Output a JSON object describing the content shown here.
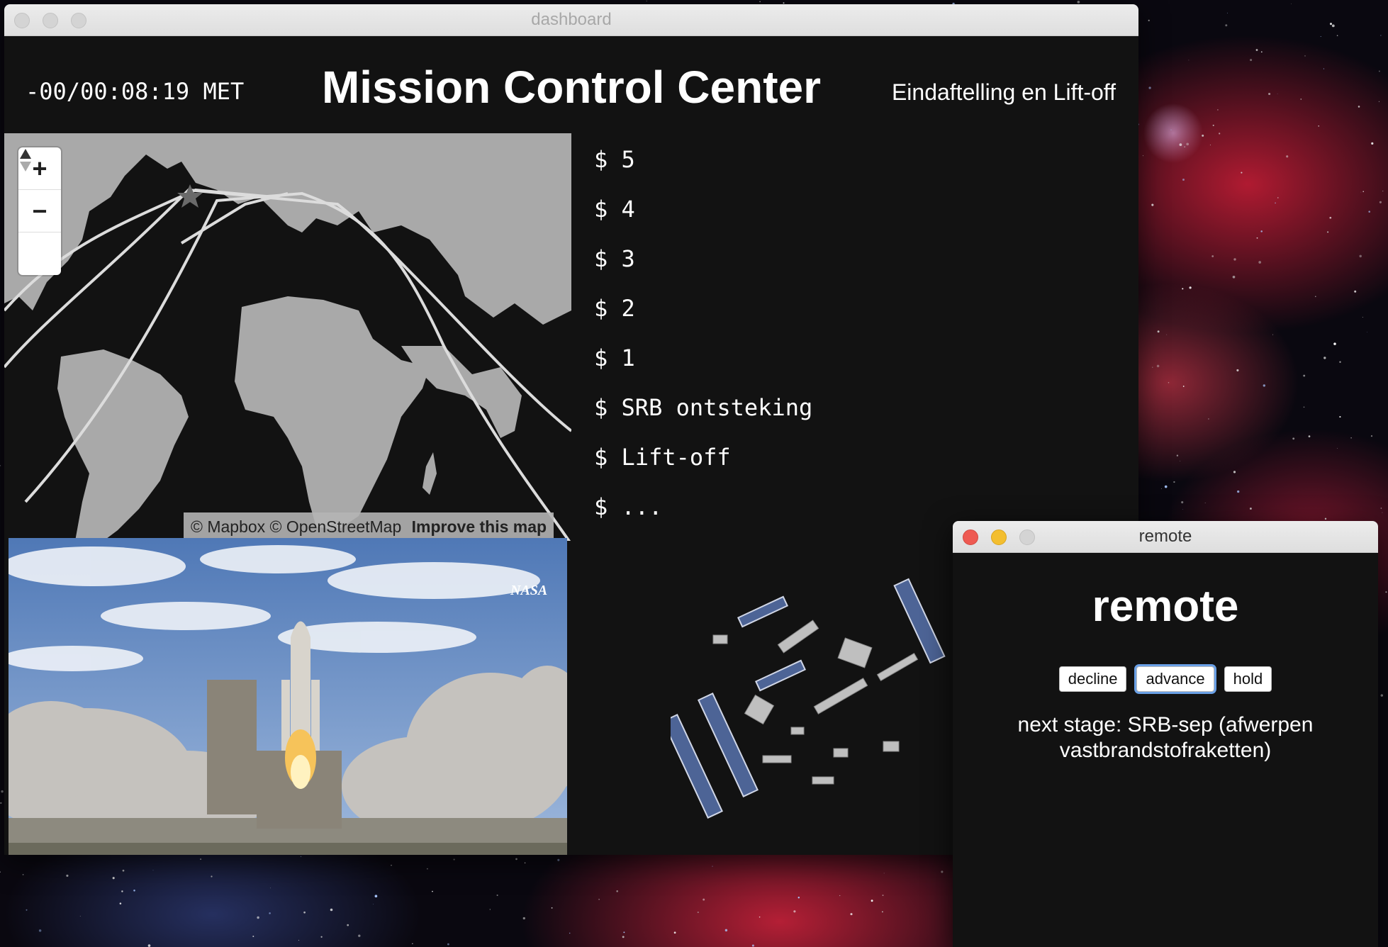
{
  "dashboard_window": {
    "title": "dashboard",
    "mission_elapsed_time": "-00/00:08:19 MET",
    "heading": "Mission Control Center",
    "phase": "Eindaftelling en Lift-off",
    "map": {
      "zoom_in_label": "+",
      "zoom_out_label": "−",
      "compass_icon": "compass-icon",
      "attribution": "© Mapbox © OpenStreetMap",
      "improve_link": "Improve this map"
    },
    "console_lines": [
      "$ 5",
      "$ 4",
      "$ 3",
      "$ 2",
      "$ 1",
      "$ SRB ontsteking",
      "$ Lift-off",
      "$ ..."
    ],
    "launch_image": {
      "logo_text": "NASA"
    }
  },
  "remote_window": {
    "title": "remote",
    "heading": "remote",
    "buttons": {
      "decline": "decline",
      "advance": "advance",
      "hold": "hold"
    },
    "next_stage": "next stage: SRB-sep (afwerpen vastbrandstofraketten)"
  },
  "colors": {
    "window_bg": "#121212",
    "map_land": "#a9a9a9",
    "map_track": "#dcdcdc",
    "close_red": "#ee5a52",
    "minimize_yellow": "#f3be2f"
  }
}
